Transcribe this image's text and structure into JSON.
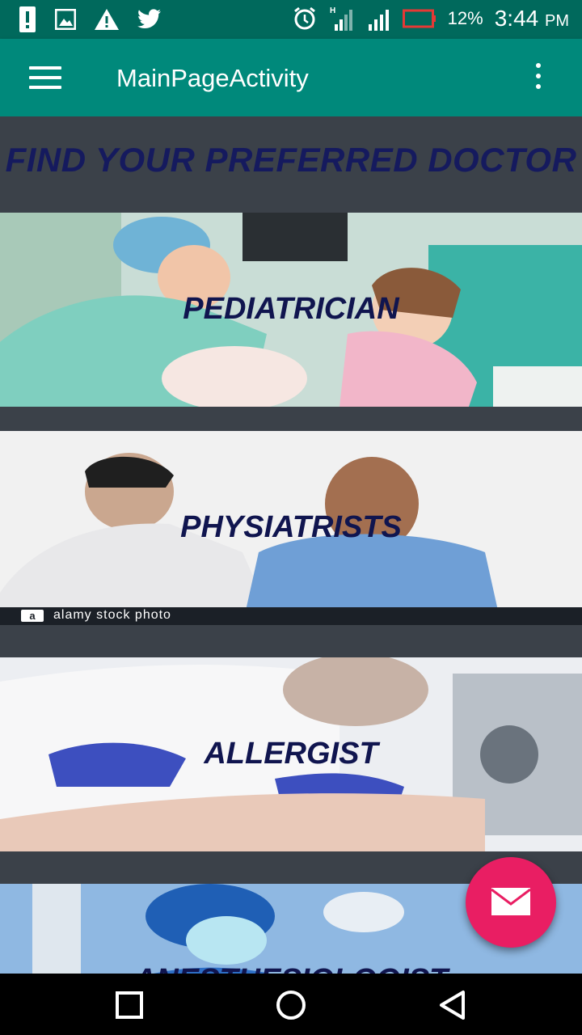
{
  "status_bar": {
    "battery_percent": "12%",
    "time": "3:44",
    "ampm": "PM",
    "icons": [
      "alert-icon",
      "image-icon",
      "warning-icon",
      "twitter-icon",
      "alarm-icon",
      "h-signal-icon",
      "signal-icon",
      "battery-icon"
    ]
  },
  "app_bar": {
    "title": "MainPageActivity",
    "menu_icon": "hamburger-menu-icon",
    "overflow_icon": "more-vert-icon"
  },
  "main": {
    "heading": "FIND YOUR PREFERRED DOCTOR",
    "cards": [
      {
        "label": "PEDIATRICIAN"
      },
      {
        "label": "PHYSIATRISTS",
        "watermark": "alamy stock photo",
        "watermark_logo": "a"
      },
      {
        "label": "ALLERGIST"
      },
      {
        "label": "ANESTHESIOLOGIST"
      }
    ]
  },
  "fab": {
    "icon": "mail-icon"
  },
  "nav_bar": {
    "icons": [
      "recent-apps-icon",
      "home-icon",
      "back-icon"
    ]
  },
  "colors": {
    "status_bar": "#00695c",
    "app_bar": "#00897b",
    "background": "#3b4149",
    "heading_text": "#151a5e",
    "fab": "#e91e63"
  }
}
